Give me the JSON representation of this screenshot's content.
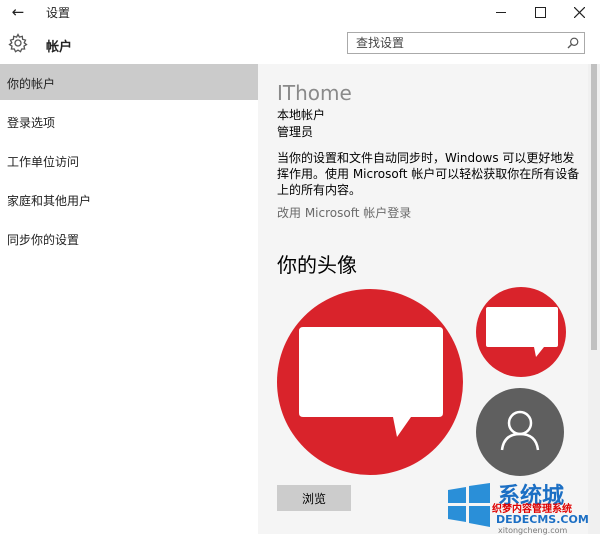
{
  "window": {
    "title": "设置",
    "section": "帐户",
    "back_icon": "back-arrow-icon",
    "gear_icon": "gear-icon",
    "controls": [
      "minimize-icon",
      "maximize-icon",
      "close-icon"
    ]
  },
  "search": {
    "placeholder": "查找设置",
    "icon": "search-icon"
  },
  "sidebar": {
    "active_index": 0,
    "items": [
      {
        "label": "你的帐户"
      },
      {
        "label": "登录选项"
      },
      {
        "label": "工作单位访问"
      },
      {
        "label": "家庭和其他用户"
      },
      {
        "label": "同步你的设置"
      }
    ]
  },
  "account": {
    "name": "IThome",
    "type": "本地帐户",
    "role": "管理员",
    "description": "当你的设置和文件自动同步时，Windows 可以更好地发挥作用。使用 Microsoft 帐户可以轻松获取你在所有设备上的所有内容。",
    "switch_link": "改用 Microsoft 帐户登录"
  },
  "avatar": {
    "heading": "你的头像",
    "browse_label": "浏览",
    "colors": {
      "red": "#d9232b",
      "gray": "#5f5f5f"
    }
  },
  "watermark": {
    "line1": "系统城",
    "line2": "织梦内容管理系统",
    "line3": "DEDECMS.COM",
    "line4": "xitongcheng.com"
  },
  "colors": {
    "sidebar_active": "#cbcbcb",
    "content_bg": "#f5f5f5",
    "accent_red": "#d9232b"
  }
}
